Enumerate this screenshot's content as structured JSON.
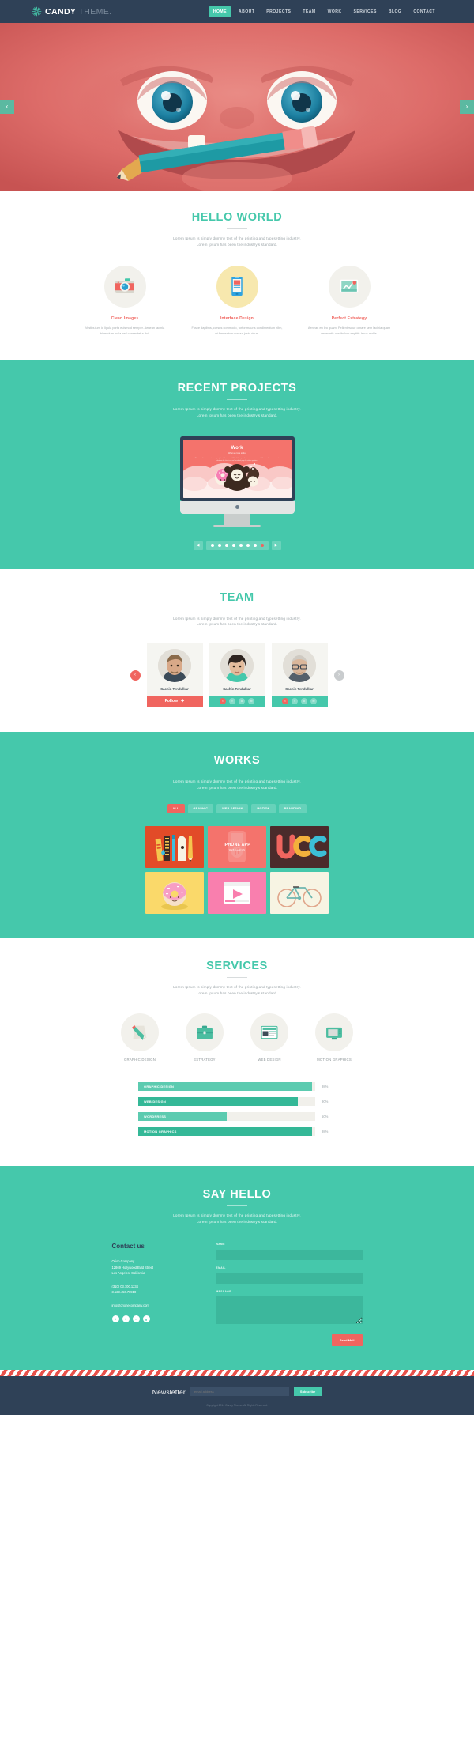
{
  "colors": {
    "navy": "#2f4157",
    "teal": "#45c8ab",
    "coral": "#f0655f",
    "hero_red": "#d9605f",
    "cream": "#f2f1ec",
    "yellow": "#f7e8ae"
  },
  "header": {
    "brand_main": "CANDY ",
    "brand_light": "THEME.",
    "logo_icon": "starburst-icon",
    "nav": [
      {
        "label": "HOME",
        "active": true
      },
      {
        "label": "ABOUT",
        "active": false
      },
      {
        "label": "PROJECTS",
        "active": false
      },
      {
        "label": "TEAM",
        "active": false
      },
      {
        "label": "WORK",
        "active": false
      },
      {
        "label": "SERVICES",
        "active": false
      },
      {
        "label": "BLOG",
        "active": false
      },
      {
        "label": "CONTACT",
        "active": false
      }
    ]
  },
  "hero": {
    "prev_arrow": "‹",
    "next_arrow": "›"
  },
  "hello": {
    "title": "HELLO WORLD",
    "sub_line1": "Lorem Ipsum is simply dummy text of the printing and typesetting industry.",
    "sub_line2": "Lorem Ipsum has been the industry's standard.",
    "features": [
      {
        "icon": "camera-icon",
        "title": "Clean Images",
        "body": "Vestibulum id ligula porta euismod semper. Aenean lacinia bibendum nulla sed consectetur dui."
      },
      {
        "icon": "tablet-icon",
        "title": "Interface Design",
        "body": "Fusce dapibus, cursus commodo, tortor mauris condimentum nibh, ut fermentum massa justo risus."
      },
      {
        "icon": "chart-image-icon",
        "title": "Perfect Estrategy",
        "body": "Aenean eu leo quam. Pellentesque ornare sem lacinia quam venenatis vestibulum sagittis lacus mollis."
      }
    ]
  },
  "projects": {
    "title": "RECENT PROJECTS",
    "sub_line1": "Lorem Ipsum is simply dummy text of the printing and typesetting industry.",
    "sub_line2": "Lorem Ipsum has been the industry's standard.",
    "screen": {
      "heading": "Work",
      "subheading": "What we love to do.",
      "paragraph": "We are working on a series over projects at the moment. Watch this space for more announcements. You can learn more about what we do, check out our Facebook page for status updates."
    },
    "carousel": {
      "prev": "◀",
      "next": "▶",
      "dot_count": 8,
      "active_index": 7
    }
  },
  "team": {
    "title": "TEAM",
    "sub_line1": "Lorem Ipsum is simply dummy text of the printing and typesetting industry.",
    "sub_line2": "Lorem Ipsum has been the industry's standard.",
    "prev_arrow": "‹",
    "next_arrow": "›",
    "members": [
      {
        "name": "Sachin Tendulkar",
        "action_type": "follow",
        "action_label": "Follow",
        "action_icon": "plus-icon"
      },
      {
        "name": "Sachin Tendulkar",
        "action_type": "social",
        "socials": [
          "twitter-icon",
          "facebook-icon",
          "flickr-icon",
          "mail-icon"
        ]
      },
      {
        "name": "Sachin Tendulkar",
        "action_type": "social",
        "socials": [
          "twitter-icon",
          "facebook-icon",
          "flickr-icon",
          "mail-icon"
        ]
      }
    ]
  },
  "works": {
    "title": "WORKS",
    "sub_line1": "Lorem Ipsum is simply dummy text of the printing and typesetting industry.",
    "sub_line2": "Lorem Ipsum has been the industry's standard.",
    "filters": [
      {
        "label": "ALL",
        "active": true
      },
      {
        "label": "GRAPHIC",
        "active": false
      },
      {
        "label": "WEB DESIGN",
        "active": false
      },
      {
        "label": "MOTION",
        "active": false
      },
      {
        "label": "BRANDING",
        "active": false
      }
    ],
    "tiles": [
      {
        "name": "art-supplies-tile",
        "bg": "#e24b28",
        "label": "",
        "sub": ""
      },
      {
        "name": "iphone-app-tile",
        "bg": "#f4736c",
        "label": "IPHONE APP",
        "sub": "WEB DESIGN"
      },
      {
        "name": "ucc-logo-tile",
        "bg": "#4b2b2b",
        "label": "UCC",
        "sub": ""
      },
      {
        "name": "donut-tile",
        "bg": "#fad96a",
        "label": "",
        "sub": ""
      },
      {
        "name": "video-player-tile",
        "bg": "#f97fae",
        "label": "",
        "sub": ""
      },
      {
        "name": "bicycle-tile",
        "bg": "#f7f4e3",
        "label": "",
        "sub": ""
      }
    ]
  },
  "services": {
    "title": "SERVICES",
    "sub_line1": "Lorem Ipsum is simply dummy text of the printing and typesetting industry.",
    "sub_line2": "Lorem Ipsum has been the industry's standard.",
    "items": [
      {
        "icon": "pencil-paper-icon",
        "label": "GRAPHIC DESIGN"
      },
      {
        "icon": "briefcase-icon",
        "label": "ESTRATEGY"
      },
      {
        "icon": "browser-window-icon",
        "label": "WEB DESIGN"
      },
      {
        "icon": "monitor-icon",
        "label": "MOTION GRAPHICS"
      }
    ],
    "skills": [
      {
        "label": "GRAPHIC DESIGN",
        "percent": 98,
        "percent_label": "98%",
        "color": "#5ccbb0"
      },
      {
        "label": "WEB DESIGN",
        "percent": 90,
        "percent_label": "90%",
        "color": "#34b897"
      },
      {
        "label": "WORDPRESS",
        "percent": 50,
        "percent_label": "50%",
        "color": "#5ccbb0"
      },
      {
        "label": "MOTION GRAPHICS",
        "percent": 98,
        "percent_label": "98%",
        "color": "#34b897"
      }
    ]
  },
  "contact": {
    "title": "SAY HELLO",
    "sub_line1": "Lorem Ipsum is simply dummy text of the printing and typesetting industry.",
    "sub_line2": "Lorem Ipsum has been the industry's standard.",
    "heading": "Contact us",
    "company": "Orion Company",
    "street": "12869 Hollywood Bvld Street",
    "city": "Los Angeles, California",
    "phone1": "(310) 03.700.1234",
    "phone2": "3.123.456.78910",
    "email": "info@orionecompany.com",
    "socials": [
      "twitter-icon",
      "facebook-icon",
      "flickr-icon",
      "google-plus-icon"
    ],
    "form": {
      "name_label": "NAME",
      "name_value": "",
      "email_label": "EMAIL",
      "email_value": "",
      "message_label": "MESSAGE",
      "message_value": "",
      "send_label": "Send Mail"
    }
  },
  "footer": {
    "newsletter_title": "Newsletter",
    "newsletter_placeholder": "email address",
    "newsletter_value": "",
    "subscribe_label": "Subscribe",
    "note": "Copyright 2014 Candy Theme. All Rights Reserved."
  }
}
